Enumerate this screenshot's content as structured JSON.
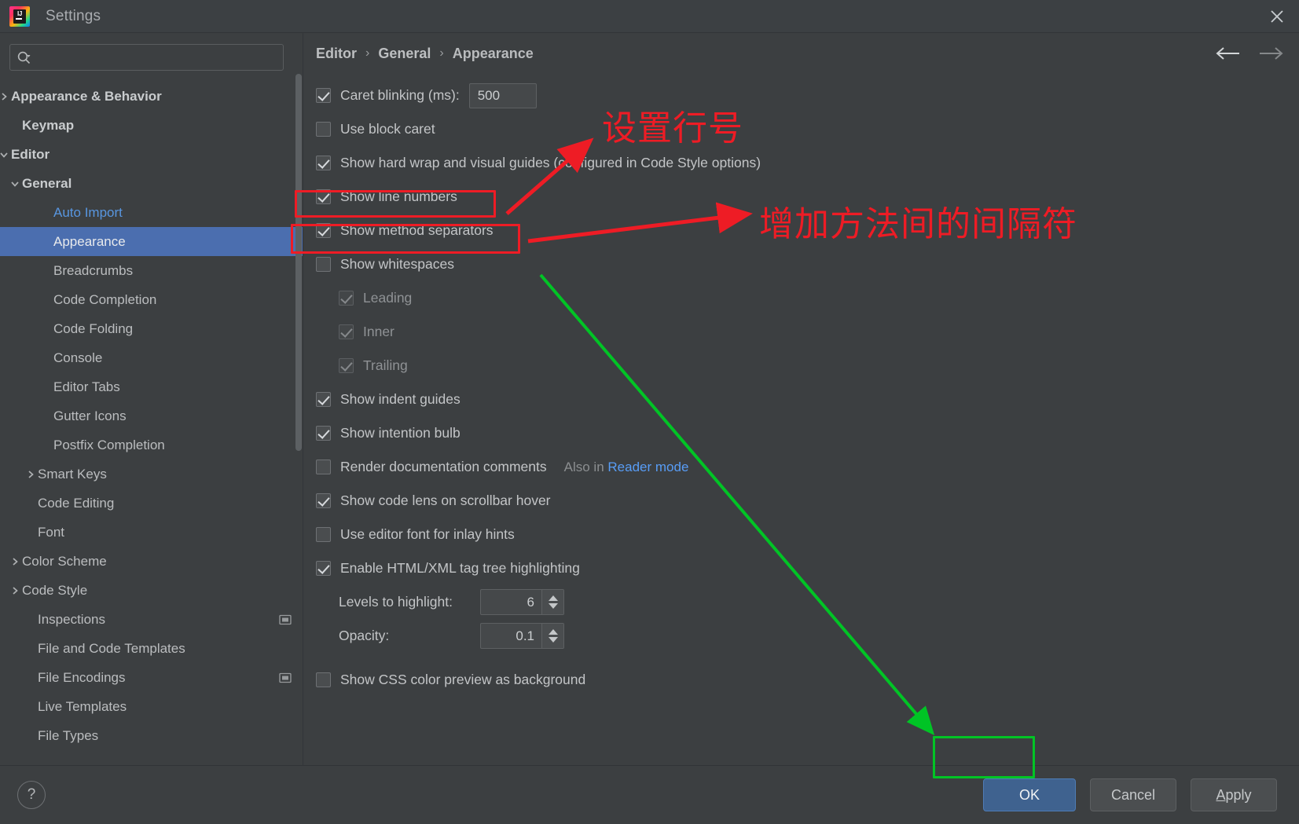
{
  "window": {
    "title": "Settings",
    "app_icon": "intellij-idea-icon",
    "close_icon": "close-icon"
  },
  "search": {
    "placeholder": "",
    "value": "",
    "icon": "search-icon"
  },
  "sidebar": {
    "items": [
      {
        "label": "Appearance & Behavior",
        "indent": 0,
        "arrow": "chevron-right-icon",
        "bold": true,
        "selected": false,
        "modified": false,
        "side_icon": ""
      },
      {
        "label": "Keymap",
        "indent": 1,
        "arrow": "",
        "bold": true,
        "selected": false,
        "modified": false,
        "side_icon": ""
      },
      {
        "label": "Editor",
        "indent": 0,
        "arrow": "chevron-down-icon",
        "bold": true,
        "selected": false,
        "modified": false,
        "side_icon": ""
      },
      {
        "label": "General",
        "indent": 1,
        "arrow": "chevron-down-icon",
        "bold": true,
        "selected": false,
        "modified": false,
        "side_icon": ""
      },
      {
        "label": "Auto Import",
        "indent": 3,
        "arrow": "",
        "bold": false,
        "selected": false,
        "modified": true,
        "side_icon": ""
      },
      {
        "label": "Appearance",
        "indent": 3,
        "arrow": "",
        "bold": false,
        "selected": true,
        "modified": false,
        "side_icon": ""
      },
      {
        "label": "Breadcrumbs",
        "indent": 3,
        "arrow": "",
        "bold": false,
        "selected": false,
        "modified": false,
        "side_icon": ""
      },
      {
        "label": "Code Completion",
        "indent": 3,
        "arrow": "",
        "bold": false,
        "selected": false,
        "modified": false,
        "side_icon": ""
      },
      {
        "label": "Code Folding",
        "indent": 3,
        "arrow": "",
        "bold": false,
        "selected": false,
        "modified": false,
        "side_icon": ""
      },
      {
        "label": "Console",
        "indent": 3,
        "arrow": "",
        "bold": false,
        "selected": false,
        "modified": false,
        "side_icon": ""
      },
      {
        "label": "Editor Tabs",
        "indent": 3,
        "arrow": "",
        "bold": false,
        "selected": false,
        "modified": false,
        "side_icon": ""
      },
      {
        "label": "Gutter Icons",
        "indent": 3,
        "arrow": "",
        "bold": false,
        "selected": false,
        "modified": false,
        "side_icon": ""
      },
      {
        "label": "Postfix Completion",
        "indent": 3,
        "arrow": "",
        "bold": false,
        "selected": false,
        "modified": false,
        "side_icon": ""
      },
      {
        "label": "Smart Keys",
        "indent": 2,
        "arrow": "chevron-right-icon",
        "bold": false,
        "selected": false,
        "modified": false,
        "side_icon": ""
      },
      {
        "label": "Code Editing",
        "indent": 2,
        "arrow": "",
        "bold": false,
        "selected": false,
        "modified": false,
        "side_icon": ""
      },
      {
        "label": "Font",
        "indent": 2,
        "arrow": "",
        "bold": false,
        "selected": false,
        "modified": false,
        "side_icon": ""
      },
      {
        "label": "Color Scheme",
        "indent": 1,
        "arrow": "chevron-right-icon",
        "bold": false,
        "selected": false,
        "modified": false,
        "side_icon": ""
      },
      {
        "label": "Code Style",
        "indent": 1,
        "arrow": "chevron-right-icon",
        "bold": false,
        "selected": false,
        "modified": false,
        "side_icon": ""
      },
      {
        "label": "Inspections",
        "indent": 2,
        "arrow": "",
        "bold": false,
        "selected": false,
        "modified": false,
        "side_icon": "project-scope-icon"
      },
      {
        "label": "File and Code Templates",
        "indent": 2,
        "arrow": "",
        "bold": false,
        "selected": false,
        "modified": false,
        "side_icon": ""
      },
      {
        "label": "File Encodings",
        "indent": 2,
        "arrow": "",
        "bold": false,
        "selected": false,
        "modified": false,
        "side_icon": "project-scope-icon"
      },
      {
        "label": "Live Templates",
        "indent": 2,
        "arrow": "",
        "bold": false,
        "selected": false,
        "modified": false,
        "side_icon": ""
      },
      {
        "label": "File Types",
        "indent": 2,
        "arrow": "",
        "bold": false,
        "selected": false,
        "modified": false,
        "side_icon": ""
      }
    ]
  },
  "breadcrumb": {
    "items": [
      "Editor",
      "General",
      "Appearance"
    ],
    "separator": "›",
    "back_icon": "arrow-left-icon",
    "forward_icon": "arrow-right-icon"
  },
  "settings": {
    "caret_blinking": {
      "label": "Caret blinking (ms):",
      "checked": true,
      "value": "500"
    },
    "use_block_caret": {
      "label": "Use block caret",
      "checked": false
    },
    "show_hard_wrap": {
      "label": "Show hard wrap and visual guides (configured in Code Style options)",
      "checked": true
    },
    "show_line_numbers": {
      "label": "Show line numbers",
      "checked": true
    },
    "show_method_separators": {
      "label": "Show method separators",
      "checked": true
    },
    "show_whitespaces": {
      "label": "Show whitespaces",
      "checked": false
    },
    "leading": {
      "label": "Leading",
      "checked": true,
      "disabled": true
    },
    "inner": {
      "label": "Inner",
      "checked": true,
      "disabled": true
    },
    "trailing": {
      "label": "Trailing",
      "checked": true,
      "disabled": true
    },
    "show_indent_guides": {
      "label": "Show indent guides",
      "checked": true
    },
    "show_intention_bulb": {
      "label": "Show intention bulb",
      "checked": true
    },
    "render_doc_comments": {
      "label": "Render documentation comments",
      "checked": false,
      "note_prefix": "Also in",
      "note_link": "Reader mode"
    },
    "show_code_lens": {
      "label": "Show code lens on scrollbar hover",
      "checked": true
    },
    "use_editor_font_inlay": {
      "label": "Use editor font for inlay hints",
      "checked": false
    },
    "enable_tag_tree": {
      "label": "Enable HTML/XML tag tree highlighting",
      "checked": true
    },
    "levels_to_highlight": {
      "label": "Levels to highlight:",
      "value": "6"
    },
    "opacity": {
      "label": "Opacity:",
      "value": "0.1"
    },
    "show_css_color_preview": {
      "label": "Show CSS color preview as background",
      "checked": false
    }
  },
  "footer": {
    "help_label": "?",
    "ok_label": "OK",
    "cancel_label": "Cancel",
    "apply_mnemonic": "A",
    "apply_rest": "pply"
  },
  "annotations": {
    "note_line_numbers": "设置行号",
    "note_method_separators": "增加方法间的间隔符",
    "red_color": "#ee1c25",
    "green_color": "#00c425"
  }
}
